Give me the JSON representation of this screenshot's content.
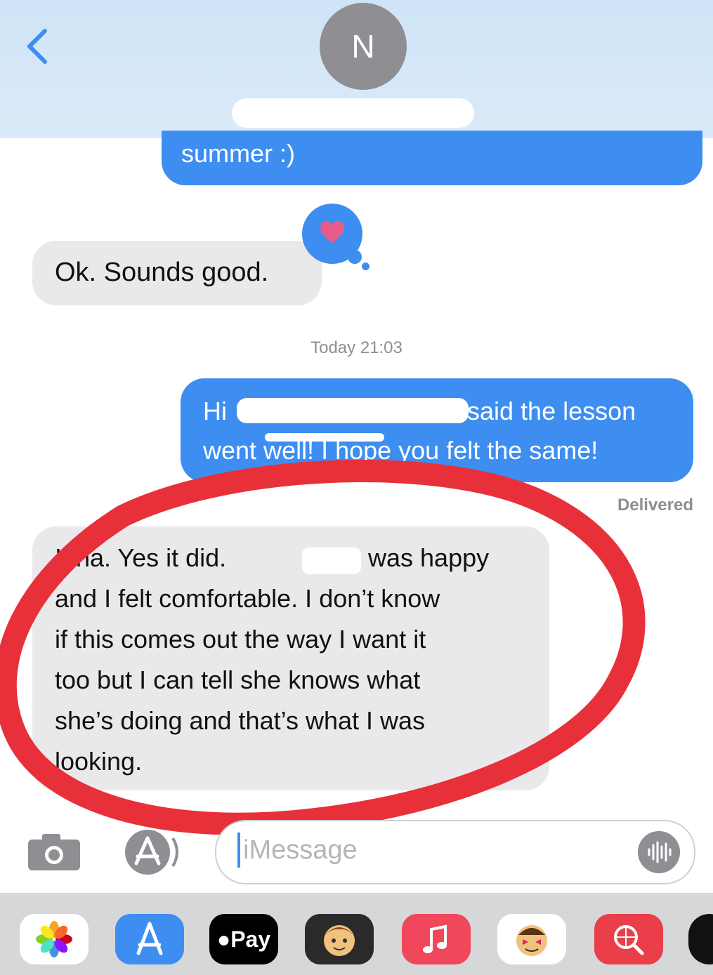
{
  "header": {
    "avatar_initial": "N",
    "back_icon": "chevron-left-icon"
  },
  "messages": [
    {
      "direction": "outgoing",
      "lines": [
        "summer :)"
      ]
    },
    {
      "direction": "incoming",
      "lines": [
        "Ok. Sounds good."
      ],
      "reaction": "heart"
    },
    {
      "direction": "outgoing",
      "lines": [
        "Hi",
        "said the lesson",
        "went well! I hope you felt the same!"
      ]
    },
    {
      "direction": "incoming",
      "lines": [
        "Irina. Yes it did.",
        "was happy",
        "and I felt comfortable. I don’t know",
        "if this comes out the way I want it",
        "too but I can tell she knows what",
        "she’s doing and that’s what I was",
        "looking."
      ]
    }
  ],
  "timestamp": "Today 21:03",
  "delivered_label": "Delivered",
  "input": {
    "placeholder": "iMessage"
  },
  "drawer": {
    "pay_label": "Pay",
    "apps": [
      "photos-icon",
      "app-store-icon",
      "apple-pay-icon",
      "memoji-icon",
      "music-icon",
      "stickers-icon",
      "web-search-icon",
      "more-icon"
    ]
  },
  "colors": {
    "outgoing_bubble": "#3d8ef0",
    "incoming_bubble": "#e9e9eb",
    "annotation_circle": "#e8303a"
  }
}
